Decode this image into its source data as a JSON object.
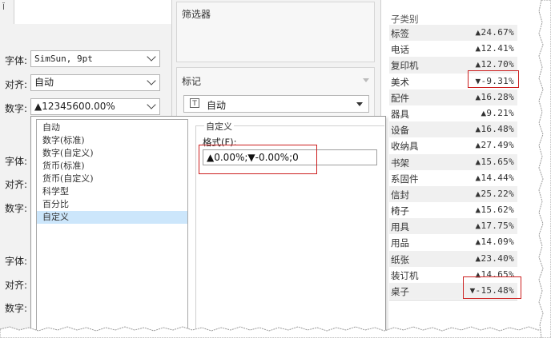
{
  "left": {
    "tab_fragment": "Ĭ",
    "rows1": {
      "font_label": "字体:",
      "font_value": "SimSun, 9pt",
      "align_label": "对齐:",
      "align_value": "自动",
      "number_label": "数字:",
      "number_value": "▲12345600.00%"
    },
    "rows2": {
      "font_label": "字体:",
      "align_label": "对齐:",
      "number_label": "数字:"
    },
    "rows3": {
      "font_label": "字体:",
      "align_label": "对齐:",
      "number_label": "数字:"
    }
  },
  "middle": {
    "filters_title": "筛选器",
    "marks_title": "标记",
    "marks_dropdown_icon": "T",
    "marks_dropdown_value": "自动"
  },
  "format_list": {
    "items": [
      "自动",
      "数字(标准)",
      "数字(自定义)",
      "货币(标准)",
      "货币(自定义)",
      "科学型",
      "百分比",
      "自定义"
    ],
    "selected_index": 7
  },
  "custom_panel": {
    "group_title": "自定义",
    "format_label": "格式(F):",
    "format_value": "▲0.00%;▼-0.00%;0"
  },
  "table": {
    "header": "子类别",
    "rows": [
      {
        "name": "标签",
        "value": "▲24.67%"
      },
      {
        "name": "电话",
        "value": "▲12.41%"
      },
      {
        "name": "复印机",
        "value": "▲12.70%"
      },
      {
        "name": "美术",
        "value": "▼-9.31%"
      },
      {
        "name": "配件",
        "value": "▲16.28%"
      },
      {
        "name": "器具",
        "value": "▲9.21%"
      },
      {
        "name": "设备",
        "value": "▲16.48%"
      },
      {
        "name": "收纳具",
        "value": "▲27.49%"
      },
      {
        "name": "书架",
        "value": "▲15.65%"
      },
      {
        "name": "系固件",
        "value": "▲14.44%"
      },
      {
        "name": "信封",
        "value": "▲25.22%"
      },
      {
        "name": "椅子",
        "value": "▲15.62%"
      },
      {
        "name": "用具",
        "value": "▲17.75%"
      },
      {
        "name": "用品",
        "value": "▲14.09%"
      },
      {
        "name": "纸张",
        "value": "▲23.40%"
      },
      {
        "name": "装订机",
        "value": "▲14.65%"
      },
      {
        "name": "桌子",
        "value": "▼-15.48%"
      }
    ]
  },
  "colors": {
    "highlight_red": "#cc1f1f",
    "selection_blue": "#cce6fb",
    "panel_gray": "#f2f2f2"
  }
}
